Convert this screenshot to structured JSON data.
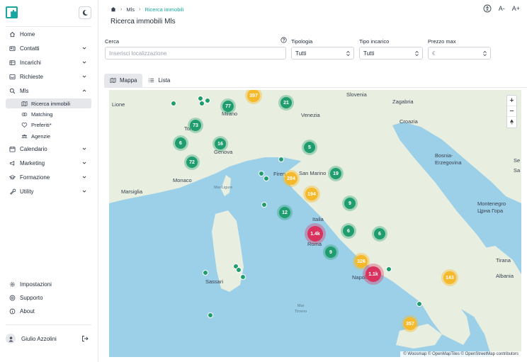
{
  "sidebar": {
    "items": [
      {
        "label": "Home",
        "icon": "home-icon"
      },
      {
        "label": "Contatti",
        "icon": "contacts-icon"
      },
      {
        "label": "Incarichi",
        "icon": "briefcase-icon"
      },
      {
        "label": "Richieste",
        "icon": "inbox-icon"
      },
      {
        "label": "Mls",
        "icon": "search-icon"
      },
      {
        "label": "Calendario",
        "icon": "calendar-icon"
      },
      {
        "label": "Marketing",
        "icon": "megaphone-icon"
      },
      {
        "label": "Formazione",
        "icon": "graduation-cap-icon"
      },
      {
        "label": "Utility",
        "icon": "wrench-icon"
      }
    ],
    "mls_sub": [
      {
        "label": "Ricerca immobili",
        "icon": "map-search-icon",
        "active": true
      },
      {
        "label": "Matching",
        "icon": "matching-icon"
      },
      {
        "label": "Preferiti*",
        "icon": "heart-icon"
      },
      {
        "label": "Agenzie",
        "icon": "agency-icon"
      }
    ],
    "bottom": [
      {
        "label": "Impostazioni",
        "icon": "gear-icon"
      },
      {
        "label": "Supporto",
        "icon": "support-icon"
      },
      {
        "label": "About",
        "icon": "info-icon"
      }
    ],
    "user": {
      "name": "Giulio Azzolini"
    }
  },
  "breadcrumb": {
    "level1": "Mls",
    "level2": "Ricerca immobili"
  },
  "top_tools": {
    "font_decrease": "A-",
    "font_increase": "A+"
  },
  "page_title": "Ricerca immobili Mls",
  "filters": {
    "cerca": {
      "label": "Cerca",
      "placeholder": "Inserisci localizzazione"
    },
    "tipologia": {
      "label": "Tipologia",
      "value": "Tutti"
    },
    "tipo_incarico": {
      "label": "Tipo incarico",
      "value": "Tutti"
    },
    "prezzo_max": {
      "label": "Prezzo max",
      "placeholder": "€"
    }
  },
  "tabs": [
    {
      "label": "Mappa",
      "active": true
    },
    {
      "label": "Lista",
      "active": false
    }
  ],
  "map": {
    "places": {
      "slovenia": "Slovenia",
      "zagabria": "Zagabria",
      "croazia": "Croazia",
      "lione": "Lione",
      "milano": "Milano",
      "venezia": "Venezia",
      "torino": "Torino",
      "genova": "Genova",
      "bosnia": "Bosnia-\nErzegovina",
      "serbia": "Se",
      "monaco": "Monaco",
      "marsiglia": "Marsiglia",
      "firenze": "Firen",
      "san_marino": "San Marino",
      "sarajevo": "Sa",
      "mar_ligure": "Mar Ligure",
      "montenegro": "Montenegro\nЦрна Гора",
      "italia": "Italia",
      "roma": "Roma",
      "tirana": "Tirana",
      "albania": "Albania",
      "sassari": "Sassari",
      "napoli": "Napoli",
      "mar_tirreno": "Mar\nTirreno"
    },
    "clusters": [
      {
        "label": "397",
        "color": "yellow"
      },
      {
        "label": "21",
        "color": "green"
      },
      {
        "label": "77",
        "color": "green"
      },
      {
        "label": "73",
        "color": "green"
      },
      {
        "label": "6",
        "color": "green"
      },
      {
        "label": "16",
        "color": "green"
      },
      {
        "label": "5",
        "color": "green"
      },
      {
        "label": "72",
        "color": "green"
      },
      {
        "label": "19",
        "color": "green"
      },
      {
        "label": "284",
        "color": "yellow"
      },
      {
        "label": "194",
        "color": "yellow"
      },
      {
        "label": "9",
        "color": "green"
      },
      {
        "label": "12",
        "color": "green"
      },
      {
        "label": "1.4k",
        "color": "red"
      },
      {
        "label": "6",
        "color": "green"
      },
      {
        "label": "6",
        "color": "green"
      },
      {
        "label": "9",
        "color": "green"
      },
      {
        "label": "326",
        "color": "yellow"
      },
      {
        "label": "1.1k",
        "color": "red"
      },
      {
        "label": "143",
        "color": "yellow"
      },
      {
        "label": "357",
        "color": "yellow"
      }
    ],
    "attribution": "© Woosmap © OpenMapTiles © OpenStreetMap contributors",
    "colors": {
      "sea": "#9cd0e8",
      "land": "#e9efe0",
      "cluster_green": "#1f9d6e",
      "cluster_yellow": "#f5b92a",
      "cluster_red": "#d9325e"
    }
  },
  "accent_color": "#1aa6a0"
}
